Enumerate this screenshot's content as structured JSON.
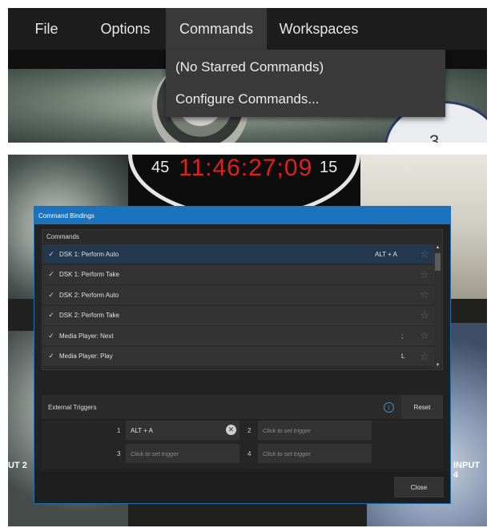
{
  "menubar": {
    "items": [
      "File",
      "Options",
      "Commands",
      "Workspaces"
    ],
    "active_index": 2
  },
  "dropdown": {
    "items": [
      "(No Starred Commands)",
      "Configure Commands..."
    ]
  },
  "background": {
    "clock_time": "11:46:27;09",
    "clock_second_left": "45",
    "clock_second_right": "15",
    "clock_face_number": "3",
    "input_left": "UT 2",
    "input_right": "INPUT 4",
    "clock_time_color": "#e0201e"
  },
  "dialog": {
    "title": "Command Bindings",
    "commands_header": "Commands",
    "commands": [
      {
        "check": "✓",
        "label": "DSK 1: Perform Auto",
        "key": "ALT + A",
        "star": "☆"
      },
      {
        "check": "✓",
        "label": "DSK 1: Perform Take",
        "key": "",
        "star": "☆"
      },
      {
        "check": "✓",
        "label": "DSK 2: Perform Auto",
        "key": "",
        "star": "☆"
      },
      {
        "check": "✓",
        "label": "DSK 2: Perform Take",
        "key": "",
        "star": "☆"
      },
      {
        "check": "✓",
        "label": "Media Player: Next",
        "key": ";",
        "star": "☆"
      },
      {
        "check": "✓",
        "label": "Media Player: Play",
        "key": "L",
        "star": "☆"
      }
    ],
    "external_triggers_label": "External Triggers",
    "info_icon": "i",
    "reset_label": "Reset",
    "triggers": [
      {
        "num": "1",
        "value": "ALT + A",
        "placeholder": ""
      },
      {
        "num": "2",
        "value": "",
        "placeholder": "Click to set trigger"
      },
      {
        "num": "3",
        "value": "",
        "placeholder": "Click to set trigger"
      },
      {
        "num": "4",
        "value": "",
        "placeholder": "Click to set trigger"
      }
    ],
    "clear_icon": "✕",
    "close_label": "Close",
    "accent_color": "#1b72bd"
  }
}
